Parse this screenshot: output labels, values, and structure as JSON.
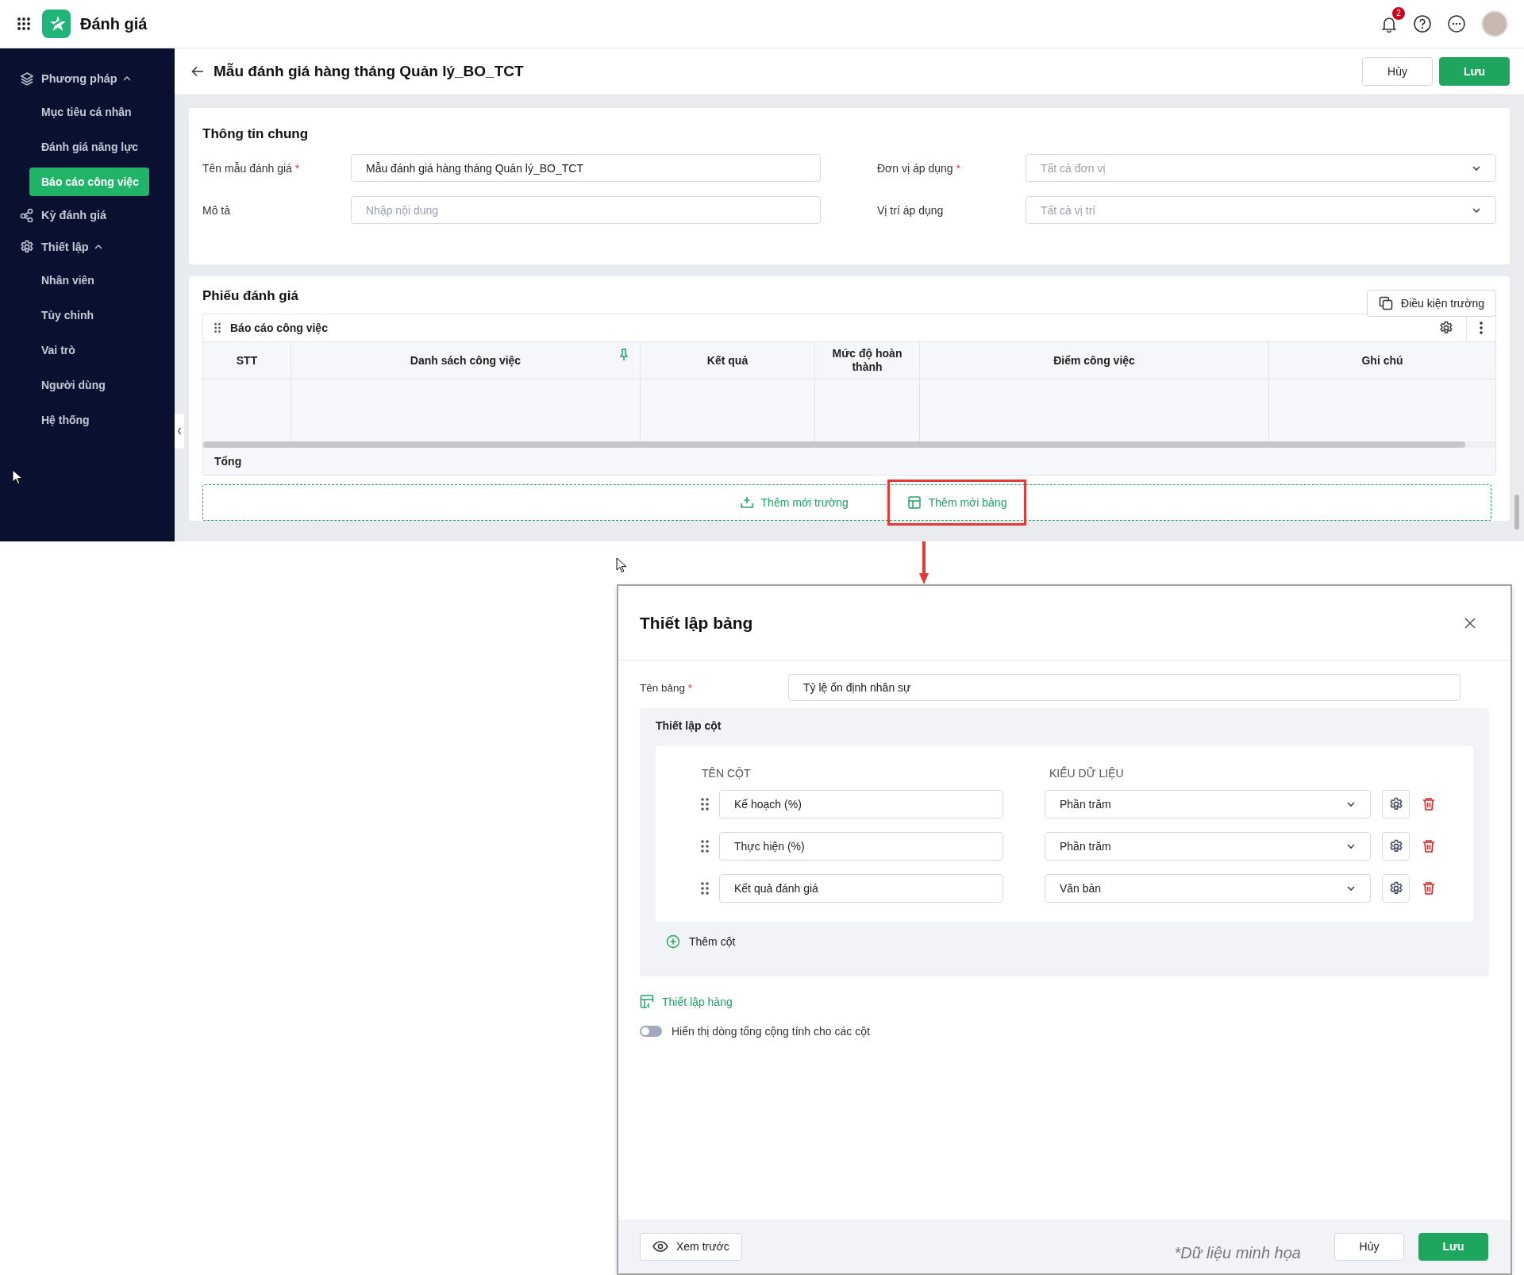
{
  "app": {
    "title": "Đánh giá",
    "notification_count": "2"
  },
  "sidebar": {
    "items": [
      {
        "kind": "group",
        "label": "Phương pháp",
        "expanded": true,
        "children": [
          {
            "label": "Mục tiêu cá nhân",
            "selected": false
          },
          {
            "label": "Đánh giá năng lực",
            "selected": false
          },
          {
            "label": "Báo cáo công việc",
            "selected": true
          }
        ]
      },
      {
        "kind": "link",
        "label": "Kỳ đánh giá"
      },
      {
        "kind": "group",
        "label": "Thiết lập",
        "expanded": true,
        "children": [
          {
            "label": "Nhân viên",
            "selected": false
          },
          {
            "label": "Tùy chỉnh",
            "selected": false
          },
          {
            "label": "Vai trò",
            "selected": false
          },
          {
            "label": "Người dùng",
            "selected": false
          },
          {
            "label": "Hệ thống",
            "selected": false
          }
        ]
      }
    ]
  },
  "page_header": {
    "title": "Mẫu đánh giá hàng tháng Quản lý_BO_TCT",
    "buttons": [
      {
        "kind": "secondary",
        "label": "Hủy"
      },
      {
        "kind": "primary",
        "label": "Lưu"
      }
    ]
  },
  "general_info": {
    "title": "Thông tin chung",
    "fields": [
      {
        "kind": "text",
        "label": "Tên mẫu đánh giá",
        "required_mark": "*",
        "value": "Mẫu đánh giá hàng tháng Quản lý_BO_TCT"
      },
      {
        "kind": "select",
        "label": "Đơn vị áp dụng",
        "required_mark": "*",
        "placeholder": "Tất cả đơn vị"
      },
      {
        "kind": "text",
        "label": "Mô tả",
        "placeholder": "Nhập nội dung"
      },
      {
        "kind": "select",
        "label": "Vị trí áp dụng",
        "placeholder": "Tất cả vị trí"
      }
    ]
  },
  "evaluation_form": {
    "title": "Phiếu đánh giá",
    "condition_button": "Điều kiện trường",
    "table": {
      "title": "Báo cáo công việc",
      "columns": [
        {
          "label": "STT",
          "pinned": false
        },
        {
          "label": "Danh sách công việc",
          "pinned": true
        },
        {
          "label": "Kết quả",
          "pinned": false
        },
        {
          "label": "Mức độ hoàn thành",
          "pinned": false
        },
        {
          "label": "Điểm công việc",
          "pinned": false
        },
        {
          "label": "Ghi chú",
          "pinned": false
        }
      ],
      "footer_label": "Tổng"
    },
    "add_buttons": [
      {
        "kind": "field",
        "label": "Thêm mới trường",
        "highlighted": false
      },
      {
        "kind": "table",
        "label": "Thêm mới bảng",
        "highlighted": true
      }
    ]
  },
  "dialog": {
    "title": "Thiết lập bảng",
    "table_name": {
      "label": "Tên bảng",
      "required_mark": "*",
      "value": "Tỷ lệ ổn định nhân sự"
    },
    "column_setup": {
      "title": "Thiết lập cột",
      "headers": [
        "TÊN CỘT",
        "KIỂU DỮ LIỆU"
      ],
      "rows": [
        {
          "name": "Kế hoạch (%)",
          "type": "Phần trăm"
        },
        {
          "name": "Thực hiện (%)",
          "type": "Phần trăm"
        },
        {
          "name": "Kết quả đánh giá",
          "type": "Văn bản"
        }
      ],
      "add_button": "Thêm cột"
    },
    "row_setup_link": "Thiết lập hàng",
    "total_toggle": {
      "label": "Hiển thị dòng tổng cộng tính cho các cột",
      "on": false
    },
    "preview_button": "Xem trước",
    "note": "*Dữ liệu minh họa",
    "buttons": [
      {
        "kind": "secondary",
        "label": "Hủy"
      },
      {
        "kind": "primary",
        "label": "Lưu"
      }
    ]
  }
}
